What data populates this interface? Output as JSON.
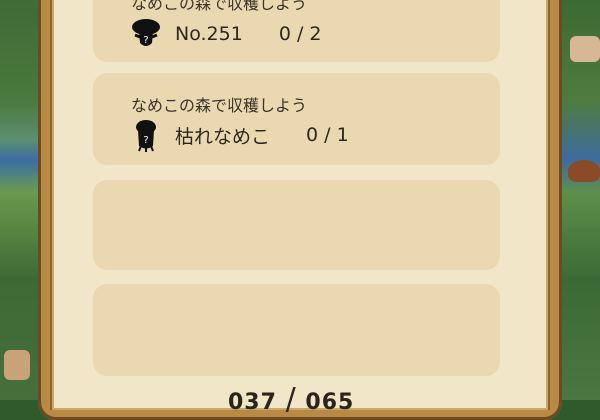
{
  "tasks": [
    {
      "title": "なめこの森で収穫しよう",
      "target": "No.251",
      "progress": "0 / 2",
      "icon": "unknown-mushroom-silhouette-icon"
    },
    {
      "title": "なめこの森で収穫しよう",
      "target": "枯れなめこ",
      "progress": "0 / 1",
      "icon": "unknown-mushroom-silhouette-icon"
    }
  ],
  "footer": {
    "current": "037",
    "separator": "/",
    "total": "065"
  },
  "colors": {
    "parchment": "#f1e6c8",
    "card": "#ead9b0",
    "frame": "#b88a46"
  }
}
